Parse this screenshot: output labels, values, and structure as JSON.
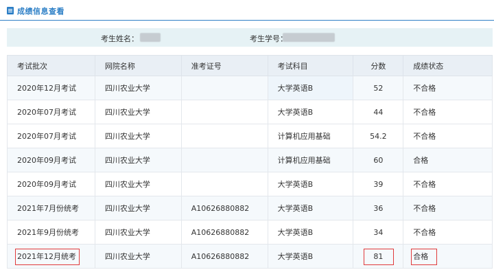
{
  "header": {
    "title": "成绩信息查看"
  },
  "info": {
    "name_label": "考生姓名：",
    "student_no_label": "考生学号："
  },
  "table": {
    "columns": [
      "考试批次",
      "网院名称",
      "准考证号",
      "考试科目",
      "分数",
      "成绩状态"
    ],
    "rows": [
      [
        "2020年12月考试",
        "四川农业大学",
        "",
        "大学英语B",
        "52",
        "不合格"
      ],
      [
        "2020年07月考试",
        "四川农业大学",
        "",
        "大学英语B",
        "44",
        "不合格"
      ],
      [
        "2020年07月考试",
        "四川农业大学",
        "",
        "计算机应用基础",
        "54.2",
        "不合格"
      ],
      [
        "2020年09月考试",
        "四川农业大学",
        "",
        "计算机应用基础",
        "60",
        "合格"
      ],
      [
        "2020年09月考试",
        "四川农业大学",
        "",
        "大学英语B",
        "39",
        "不合格"
      ],
      [
        "2021年7月份统考",
        "四川农业大学",
        "A10626880882",
        "大学英语B",
        "36",
        "不合格"
      ],
      [
        "2021年9月份统考",
        "四川农业大学",
        "A10626880882",
        "大学英语B",
        "34",
        "不合格"
      ],
      [
        "2021年12月统考",
        "四川农业大学",
        "A10626880882",
        "大学英语B",
        "81",
        "合格"
      ]
    ]
  },
  "colors": {
    "accent": "#2d7fc6",
    "highlight_box": "#e0393a"
  }
}
